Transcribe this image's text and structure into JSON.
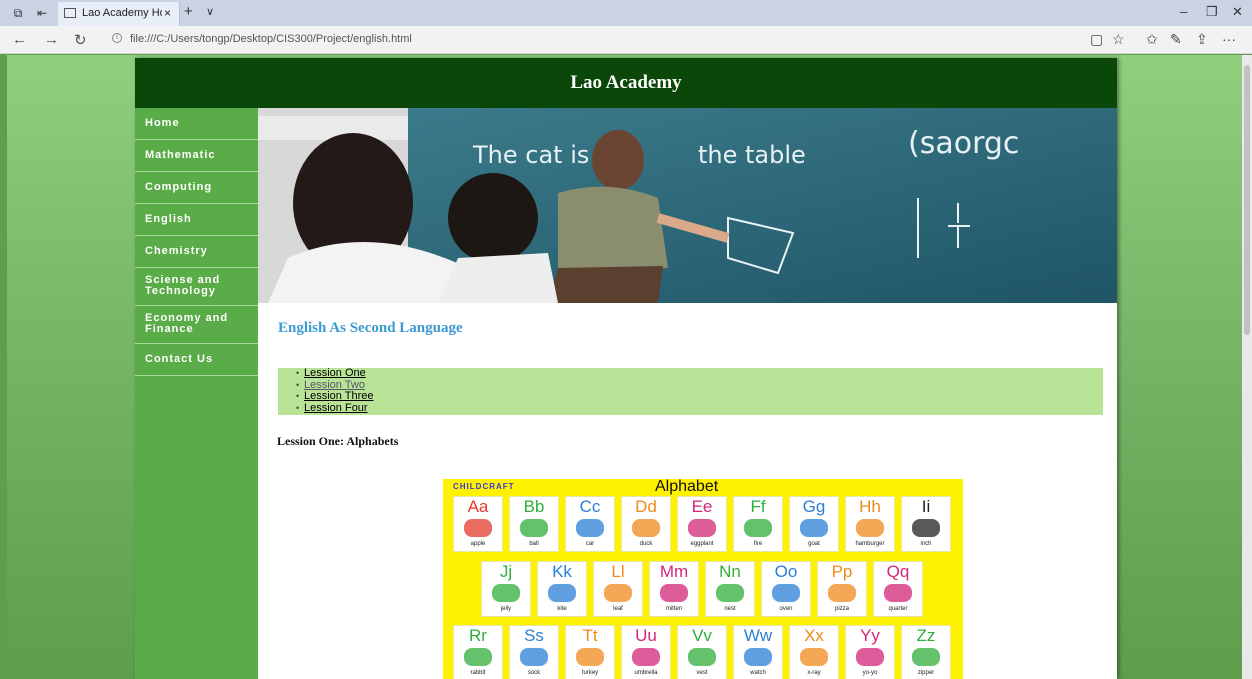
{
  "browser": {
    "tab_title": "Lao Academy Home Pag",
    "tab_close": "×",
    "new_tab": "+",
    "url": "file:///C:/Users/tongp/Desktop/CIS300/Project/english.html"
  },
  "site": {
    "title": "Lao Academy"
  },
  "sidebar": {
    "items": [
      {
        "label": "Home"
      },
      {
        "label": "Mathematic"
      },
      {
        "label": "Computing"
      },
      {
        "label": "English"
      },
      {
        "label": "Chemistry"
      },
      {
        "label": "Sciense and Technology"
      },
      {
        "label": "Economy and Finance"
      },
      {
        "label": "Contact Us"
      }
    ]
  },
  "banner": {
    "board_text_1": "The cat is",
    "board_text_2": "the table",
    "board_text_3": "(saorgc"
  },
  "main": {
    "heading": "English As Second Language",
    "lessons": [
      {
        "label": "Lession One"
      },
      {
        "label": "Lession Two"
      },
      {
        "label": "Lession Three"
      },
      {
        "label": "Lession Four"
      }
    ],
    "section_title": "Lession One: Alphabets"
  },
  "alphabet_chart": {
    "brand": "CHILDCRAFT",
    "title": "Alphabet",
    "rows": [
      [
        {
          "letter": "Aa",
          "word": "apple",
          "color": "#e23b2e"
        },
        {
          "letter": "Bb",
          "word": "ball",
          "color": "#2fae3a"
        },
        {
          "letter": "Cc",
          "word": "car",
          "color": "#2b7fd6"
        },
        {
          "letter": "Dd",
          "word": "duck",
          "color": "#f08a1c"
        },
        {
          "letter": "Ee",
          "word": "eggplant",
          "color": "#d4267a"
        },
        {
          "letter": "Ff",
          "word": "fire",
          "color": "#2fae3a"
        },
        {
          "letter": "Gg",
          "word": "goat",
          "color": "#2b7fd6"
        },
        {
          "letter": "Hh",
          "word": "hamburger",
          "color": "#f08a1c"
        },
        {
          "letter": "Ii",
          "word": "inch",
          "color": "#222222"
        }
      ],
      [
        {
          "letter": "Jj",
          "word": "jelly",
          "color": "#2fae3a"
        },
        {
          "letter": "Kk",
          "word": "kite",
          "color": "#2b7fd6"
        },
        {
          "letter": "Ll",
          "word": "leaf",
          "color": "#f08a1c"
        },
        {
          "letter": "Mm",
          "word": "mitten",
          "color": "#d4267a"
        },
        {
          "letter": "Nn",
          "word": "nest",
          "color": "#2fae3a"
        },
        {
          "letter": "Oo",
          "word": "oven",
          "color": "#2b7fd6"
        },
        {
          "letter": "Pp",
          "word": "pizza",
          "color": "#f08a1c"
        },
        {
          "letter": "Qq",
          "word": "quarter",
          "color": "#d4267a"
        }
      ],
      [
        {
          "letter": "Rr",
          "word": "rabbit",
          "color": "#2fae3a"
        },
        {
          "letter": "Ss",
          "word": "sock",
          "color": "#2b7fd6"
        },
        {
          "letter": "Tt",
          "word": "turkey",
          "color": "#f08a1c"
        },
        {
          "letter": "Uu",
          "word": "umbrella",
          "color": "#d4267a"
        },
        {
          "letter": "Vv",
          "word": "vest",
          "color": "#2fae3a"
        },
        {
          "letter": "Ww",
          "word": "watch",
          "color": "#2b7fd6"
        },
        {
          "letter": "Xx",
          "word": "x-ray",
          "color": "#f08a1c"
        },
        {
          "letter": "Yy",
          "word": "yo-yo",
          "color": "#d4267a"
        },
        {
          "letter": "Zz",
          "word": "zipper",
          "color": "#2fae3a"
        }
      ]
    ]
  }
}
